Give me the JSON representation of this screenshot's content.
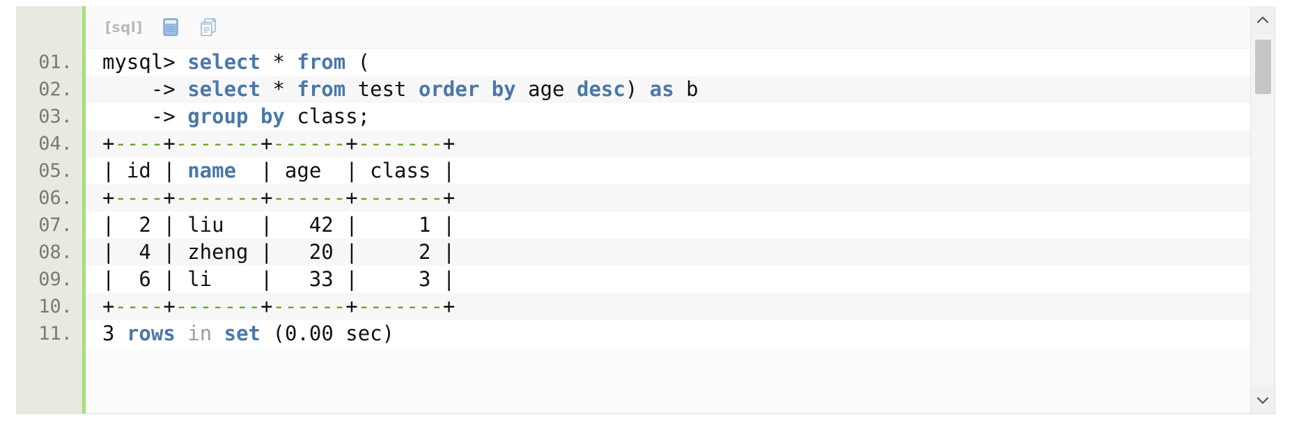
{
  "toolbar": {
    "language_label": "[sql]",
    "view_plain_icon": "view-plain-icon",
    "copy_icon": "copy-to-clipboard-icon"
  },
  "gutter": {
    "line_numbers": [
      "01.",
      "02.",
      "03.",
      "04.",
      "05.",
      "06.",
      "07.",
      "08.",
      "09.",
      "10.",
      "11."
    ]
  },
  "code": {
    "lines": [
      {
        "n": "01.",
        "text": "mysql> select * from ("
      },
      {
        "n": "02.",
        "text": "    -> select * from test order by age desc) as b"
      },
      {
        "n": "03.",
        "text": "    -> group by class;"
      },
      {
        "n": "04.",
        "text": "+----+-------+------+-------+"
      },
      {
        "n": "05.",
        "text": "| id | name  | age  | class |"
      },
      {
        "n": "06.",
        "text": "+----+-------+------+-------+"
      },
      {
        "n": "07.",
        "text": "|  2 | liu   |   42 |     1 |"
      },
      {
        "n": "08.",
        "text": "|  4 | zheng |   20 |     2 |"
      },
      {
        "n": "09.",
        "text": "|  6 | li    |   33 |     3 |"
      },
      {
        "n": "10.",
        "text": "+----+-------+------+-------+"
      },
      {
        "n": "11.",
        "text": "3 rows in set (0.00 sec)"
      }
    ],
    "keywords": [
      "select",
      "from",
      "order",
      "by",
      "desc",
      "as",
      "group",
      "name",
      "rows",
      "set"
    ],
    "prompt": "mysql>",
    "continuation": "->",
    "result_table": {
      "columns": [
        "id",
        "name",
        "age",
        "class"
      ],
      "rows": [
        [
          "2",
          "liu",
          "42",
          "1"
        ],
        [
          "4",
          "zheng",
          "20",
          "2"
        ],
        [
          "6",
          "li",
          "33",
          "3"
        ]
      ]
    },
    "status_line": {
      "count": "3",
      "rows_word": "rows",
      "in_word": "in",
      "set_word": "set",
      "timing": "(0.00 sec)"
    }
  },
  "scrollbar": {
    "up_arrow": "chevron-up-icon",
    "down_arrow": "chevron-down-icon"
  },
  "colors": {
    "keyword": "#4a78a8",
    "dash": "#6aa61c",
    "gutter_bg": "#e9e9e0",
    "gutter_accent": "#a5de7a",
    "alt_row": "#f7f7f7"
  }
}
